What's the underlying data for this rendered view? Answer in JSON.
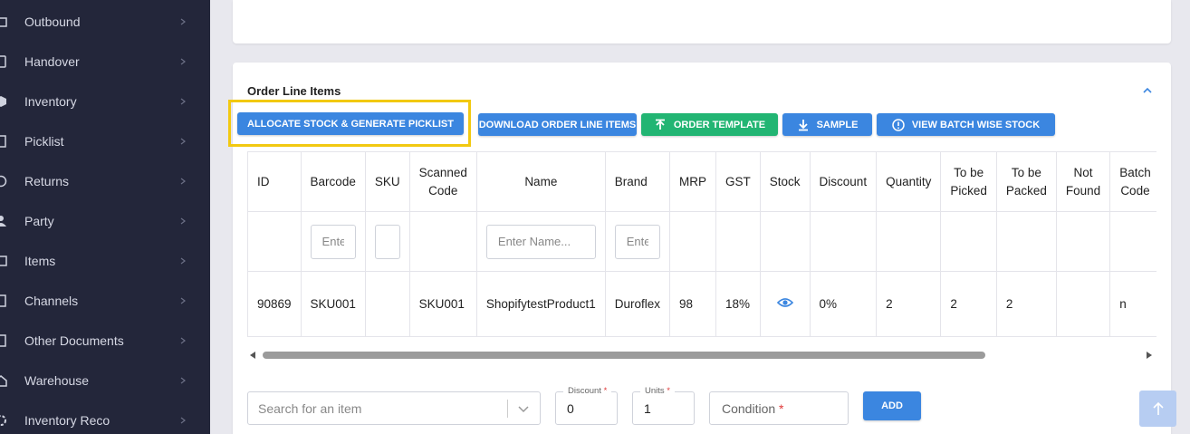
{
  "sidebar": {
    "items": [
      {
        "label": "Outbound",
        "icon": "outbound-icon"
      },
      {
        "label": "Handover",
        "icon": "handover-icon"
      },
      {
        "label": "Inventory",
        "icon": "inventory-icon"
      },
      {
        "label": "Picklist",
        "icon": "picklist-icon"
      },
      {
        "label": "Returns",
        "icon": "returns-icon"
      },
      {
        "label": "Party",
        "icon": "party-icon"
      },
      {
        "label": "Items",
        "icon": "items-icon"
      },
      {
        "label": "Channels",
        "icon": "channels-icon"
      },
      {
        "label": "Other Documents",
        "icon": "documents-icon"
      },
      {
        "label": "Warehouse",
        "icon": "warehouse-icon"
      },
      {
        "label": "Inventory Reco",
        "icon": "inventory-reco-icon"
      }
    ]
  },
  "section": {
    "title": "Order Line Items"
  },
  "toolbar": {
    "allocate": "ALLOCATE STOCK & GENERATE PICKLIST",
    "download": "DOWNLOAD ORDER LINE ITEMS",
    "template": "ORDER TEMPLATE",
    "sample": "SAMPLE",
    "batch": "VIEW BATCH WISE STOCK"
  },
  "table": {
    "headers": [
      "ID",
      "Barcode",
      "SKU",
      "Scanned Code",
      "Name",
      "Brand",
      "MRP",
      "GST",
      "Stock",
      "Discount",
      "Quantity",
      "To be Picked",
      "To be Packed",
      "Not Found",
      "Batch Code"
    ],
    "filters": {
      "barcode_placeholder": "Enter",
      "sku_placeholder": "",
      "name_placeholder": "Enter Name...",
      "brand_placeholder": "Enter"
    },
    "rows": [
      {
        "id": "90869",
        "barcode": "SKU001",
        "sku": "",
        "scanned": "SKU001",
        "name": "ShopifytestProduct1",
        "brand": "Duroflex",
        "mrp": "98",
        "gst": "18%",
        "stock": "eye-icon",
        "discount": "0%",
        "quantity": "2",
        "to_pick": "2",
        "to_pack": "2",
        "not_found": "",
        "batch": "n"
      }
    ]
  },
  "form": {
    "search_placeholder": "Search for an item",
    "discount_label": "Discount",
    "discount_value": "0",
    "units_label": "Units",
    "units_value": "1",
    "condition_label": "Condition",
    "required_mark": "*",
    "add": "ADD"
  },
  "colors": {
    "sidebar_bg": "#23263a",
    "primary": "#3b86e0",
    "success": "#22b573",
    "highlight": "#f2c911"
  }
}
